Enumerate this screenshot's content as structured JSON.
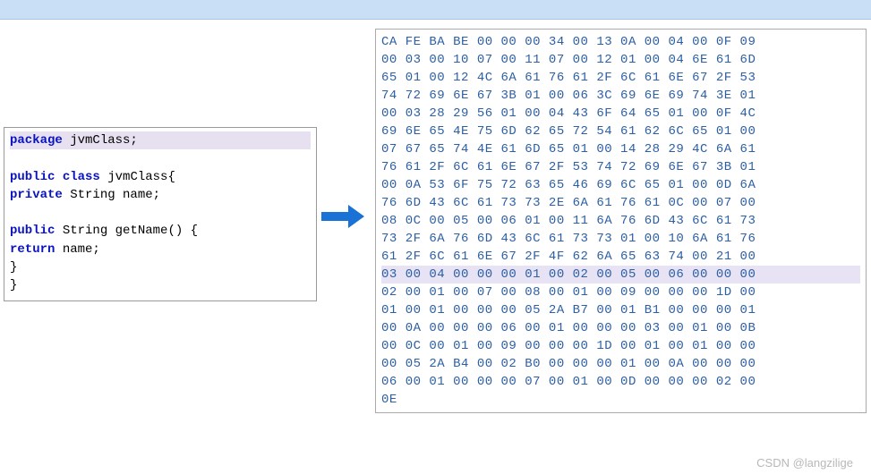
{
  "code": {
    "line1_kw": "package",
    "line1_rest": " jvmClass;",
    "blank1": "",
    "line3_kw1": "public",
    "line3_kw2": " class",
    "line3_rest": " jvmClass{",
    "line4_indent": "    ",
    "line4_kw": "private",
    "line4_rest": " String name;",
    "blank2": "",
    "line6_indent": "    ",
    "line6_kw": "public",
    "line6_rest": " String getName",
    "line6_paren": "() {",
    "line7_indent": "        ",
    "line7_kw": "return",
    "line7_rest": " name;",
    "line8": "    }",
    "line9": "}"
  },
  "hex": {
    "lines": [
      "CA FE BA BE 00 00 00 34 00 13 0A 00 04 00 0F 09",
      "00 03 00 10 07 00 11 07 00 12 01 00 04 6E 61 6D",
      "65 01 00 12 4C 6A 61 76 61 2F 6C 61 6E 67 2F 53",
      "74 72 69 6E 67 3B 01 00 06 3C 69 6E 69 74 3E 01",
      "00 03 28 29 56 01 00 04 43 6F 64 65 01 00 0F 4C",
      "69 6E 65 4E 75 6D 62 65 72 54 61 62 6C 65 01 00",
      "07 67 65 74 4E 61 6D 65 01 00 14 28 29 4C 6A 61",
      "76 61 2F 6C 61 6E 67 2F 53 74 72 69 6E 67 3B 01",
      "00 0A 53 6F 75 72 63 65 46 69 6C 65 01 00 0D 6A",
      "76 6D 43 6C 61 73 73 2E 6A 61 76 61 0C 00 07 00",
      "08 0C 00 05 00 06 01 00 11 6A 76 6D 43 6C 61 73",
      "73 2F 6A 76 6D 43 6C 61 73 73 01 00 10 6A 61 76",
      "61 2F 6C 61 6E 67 2F 4F 62 6A 65 63 74 00 21 00",
      "03 00 04 00 00 00 01 00 02 00 05 00 06 00 00 00",
      "02 00 01 00 07 00 08 00 01 00 09 00 00 00 1D 00",
      "01 00 01 00 00 00 05 2A B7 00 01 B1 00 00 00 01",
      "00 0A 00 00 00 06 00 01 00 00 00 03 00 01 00 0B",
      "00 0C 00 01 00 09 00 00 00 1D 00 01 00 01 00 00",
      "00 05 2A B4 00 02 B0 00 00 00 01 00 0A 00 00 00",
      "06 00 01 00 00 00 07 00 01 00 0D 00 00 00 02 00",
      "0E"
    ],
    "highlight_index": 13
  },
  "watermark": "CSDN @langzilige"
}
